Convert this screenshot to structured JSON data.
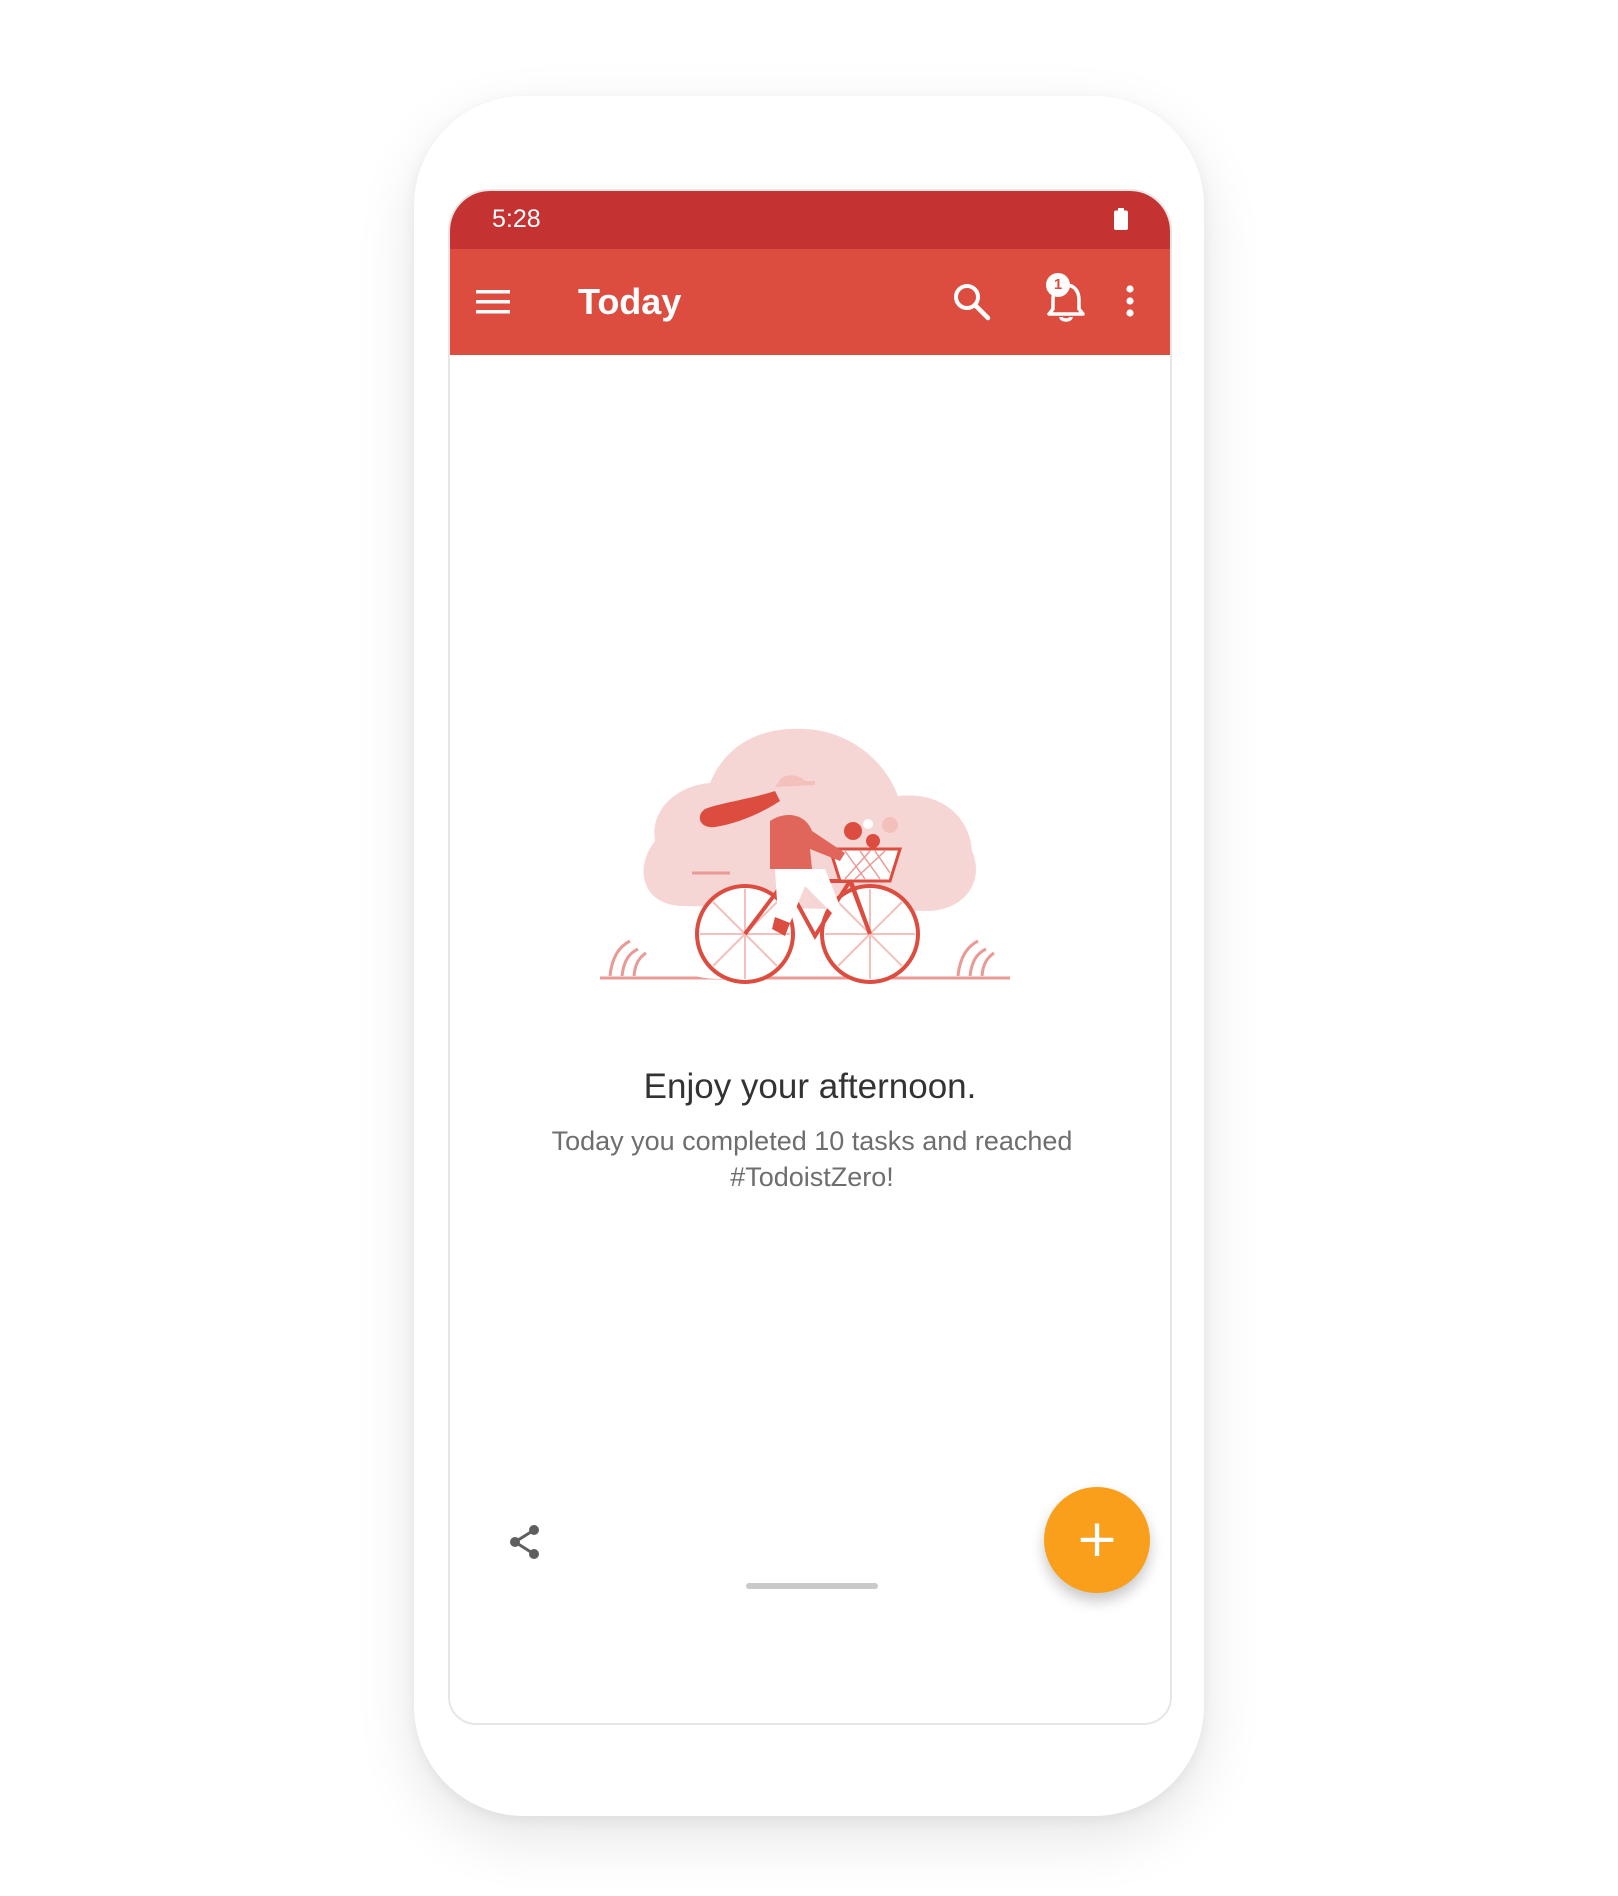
{
  "status_bar": {
    "time": "5:28",
    "battery_icon": "battery-icon"
  },
  "app_bar": {
    "title": "Today",
    "menu_icon": "hamburger-menu-icon",
    "search_icon": "search-icon",
    "notifications_icon": "bell-icon",
    "notification_count": "1",
    "more_icon": "more-vertical-icon"
  },
  "empty_state": {
    "illustration": "person-riding-bicycle-illustration",
    "title": "Enjoy your afternoon.",
    "subtitle": "Today you completed 10 tasks and reached #TodoistZero!"
  },
  "bottom": {
    "share_icon": "share-icon",
    "fab_label": "+"
  },
  "colors": {
    "status_bar": "#c53232",
    "app_bar": "#dc4c3f",
    "fab": "#f99f1b",
    "illustration_light": "#f6d6d4",
    "illustration_accent": "#dc4c3f"
  }
}
